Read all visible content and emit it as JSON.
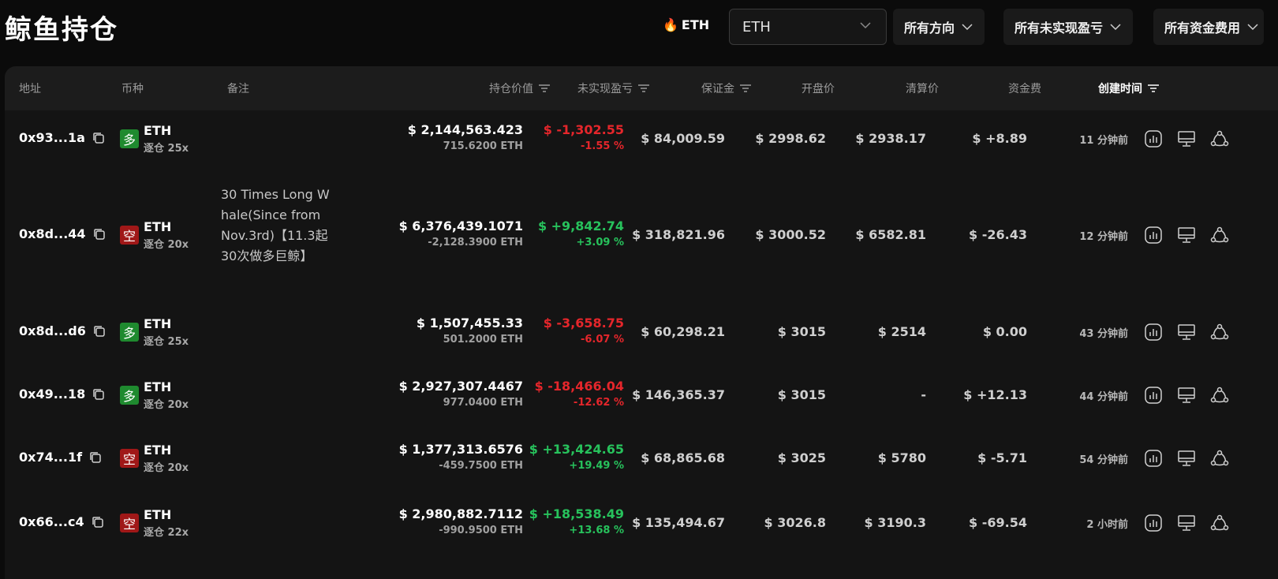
{
  "page_title": "鲸鱼持仓",
  "hot_coin": "ETH",
  "coin_select": {
    "value": "ETH"
  },
  "filters": [
    {
      "label": "所有方向"
    },
    {
      "label": "所有未实现盈亏"
    },
    {
      "label": "所有资金费用"
    }
  ],
  "columns": {
    "address": "地址",
    "coin": "币种",
    "note": "备注",
    "position_value": "持仓价值",
    "unrealized_pnl": "未实现盈亏",
    "margin": "保证金",
    "open_price": "开盘价",
    "liq_price": "清算价",
    "funding": "资金费",
    "created": "创建时间"
  },
  "colors": {
    "long": "#1f8a2f",
    "short": "#a01818",
    "positive": "#27c25c",
    "negative": "#e5262b"
  },
  "rows": [
    {
      "address": "0x93...1a",
      "side": "多",
      "side_type": "long",
      "coin": "ETH",
      "mode": "逐仓 25x",
      "note": "",
      "value": "$ 2,144,563.423",
      "size": "715.6200 ETH",
      "pnl": "$ -1,302.55",
      "pnl_pct": "-1.55 %",
      "pnl_sign": "neg",
      "margin": "$ 84,009.59",
      "open": "$ 2998.62",
      "liq": "$ 2938.17",
      "funding": "$ +8.89",
      "funding_sign": "pos",
      "time": "11 分钟前"
    },
    {
      "address": "0x8d...44",
      "side": "空",
      "side_type": "short",
      "coin": "ETH",
      "mode": "逐仓 20x",
      "note": "30 Times Long Whale(Since from Nov.3rd)【11.3起30次做多巨鲸】",
      "value": "$ 6,376,439.1071",
      "size": "-2,128.3900 ETH",
      "pnl": "$ +9,842.74",
      "pnl_pct": "+3.09 %",
      "pnl_sign": "pos",
      "margin": "$ 318,821.96",
      "open": "$ 3000.52",
      "liq": "$ 6582.81",
      "funding": "$ -26.43",
      "funding_sign": "neg",
      "time": "12 分钟前"
    },
    {
      "address": "0x8d...d6",
      "side": "多",
      "side_type": "long",
      "coin": "ETH",
      "mode": "逐仓 25x",
      "note": "",
      "value": "$ 1,507,455.33",
      "size": "501.2000 ETH",
      "pnl": "$ -3,658.75",
      "pnl_pct": "-6.07 %",
      "pnl_sign": "neg",
      "margin": "$ 60,298.21",
      "open": "$ 3015",
      "liq": "$ 2514",
      "funding": "$ 0.00",
      "funding_sign": "zero",
      "time": "43 分钟前"
    },
    {
      "address": "0x49...18",
      "side": "多",
      "side_type": "long",
      "coin": "ETH",
      "mode": "逐仓 20x",
      "note": "",
      "value": "$ 2,927,307.4467",
      "size": "977.0400 ETH",
      "pnl": "$ -18,466.04",
      "pnl_pct": "-12.62 %",
      "pnl_sign": "neg",
      "margin": "$ 146,365.37",
      "open": "$ 3015",
      "liq": "-",
      "funding": "$ +12.13",
      "funding_sign": "pos",
      "time": "44 分钟前"
    },
    {
      "address": "0x74...1f",
      "side": "空",
      "side_type": "short",
      "coin": "ETH",
      "mode": "逐仓 20x",
      "note": "",
      "value": "$ 1,377,313.6576",
      "size": "-459.7500 ETH",
      "pnl": "$ +13,424.65",
      "pnl_pct": "+19.49 %",
      "pnl_sign": "pos",
      "margin": "$ 68,865.68",
      "open": "$ 3025",
      "liq": "$ 5780",
      "funding": "$ -5.71",
      "funding_sign": "neg",
      "time": "54 分钟前"
    },
    {
      "address": "0x66...c4",
      "side": "空",
      "side_type": "short",
      "coin": "ETH",
      "mode": "逐仓 22x",
      "note": "",
      "value": "$ 2,980,882.7112",
      "size": "-990.9500 ETH",
      "pnl": "$ +18,538.49",
      "pnl_pct": "+13.68 %",
      "pnl_sign": "pos",
      "margin": "$ 135,494.67",
      "open": "$ 3026.8",
      "liq": "$ 3190.3",
      "funding": "$ -69.54",
      "funding_sign": "neg",
      "time": "2 小时前"
    }
  ]
}
